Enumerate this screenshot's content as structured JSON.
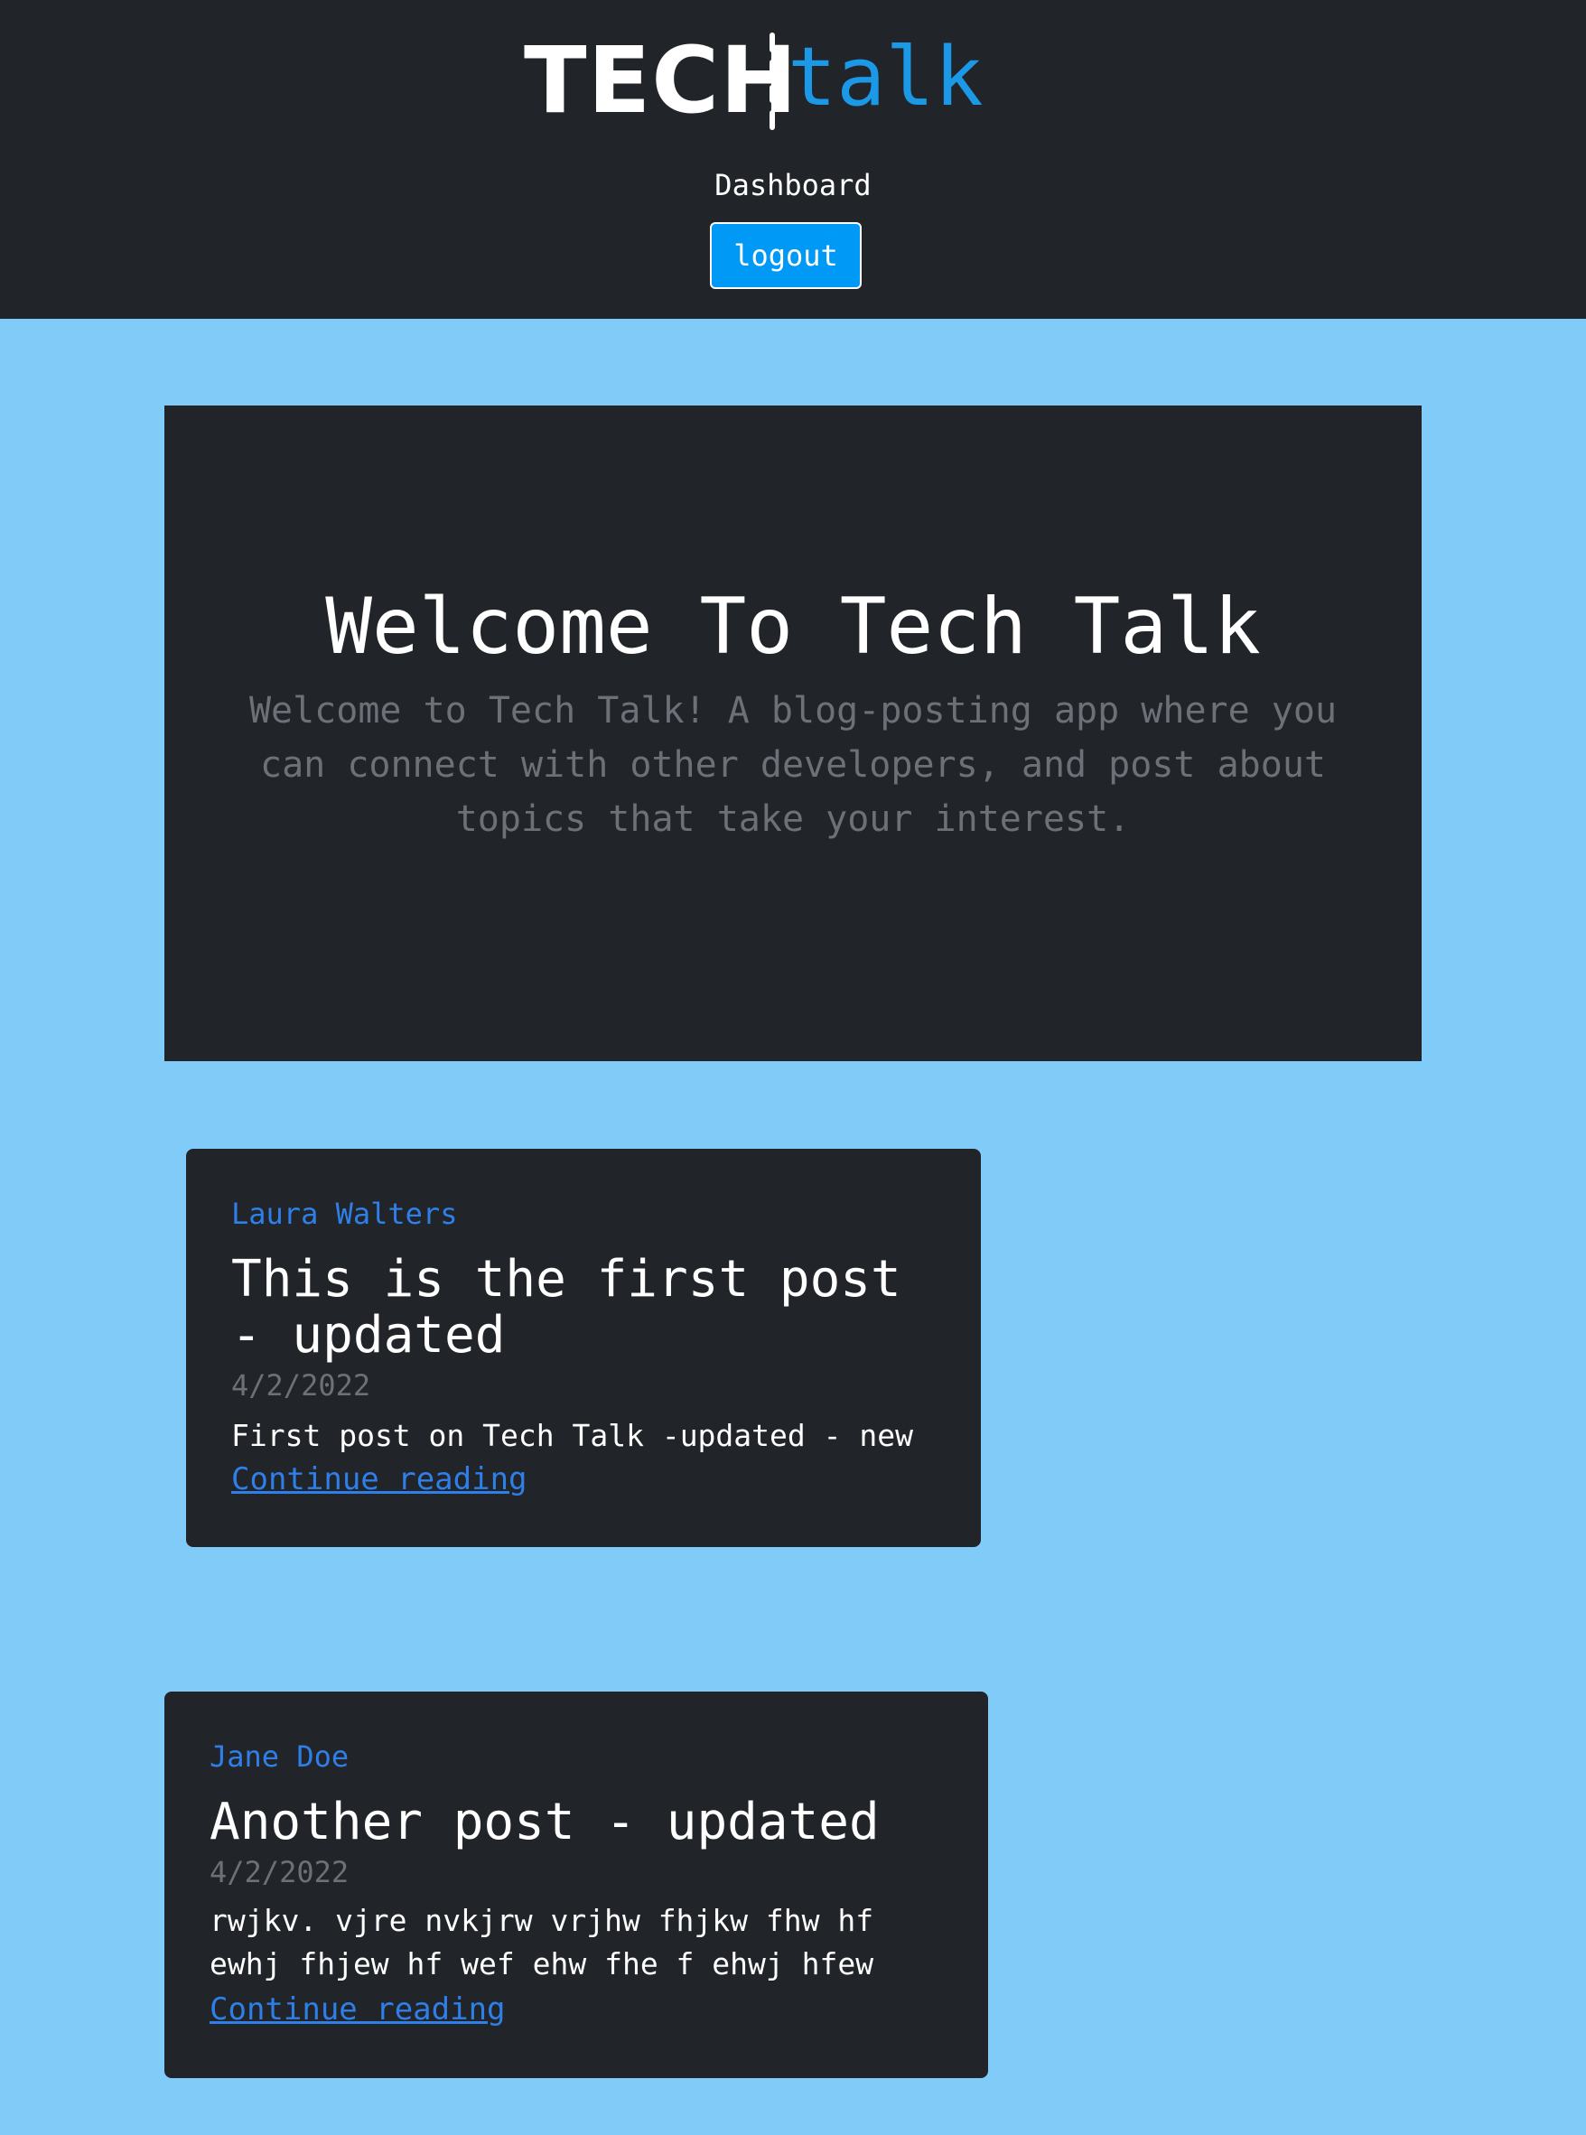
{
  "header": {
    "logo": {
      "word_bold": "TECH",
      "word_light": "talk",
      "accent_color": "#1b98e6"
    },
    "nav": {
      "dashboard_label": "Dashboard"
    },
    "logout_label": "logout",
    "logout_color": "#0199f6"
  },
  "hero": {
    "title": "Welcome To Tech Talk",
    "text": "Welcome to Tech Talk! A blog-posting app where you can connect with other developers, and post about topics that take your interest."
  },
  "posts": [
    {
      "author": "Laura Walters",
      "title": "This is the first post - updated",
      "date": "4/2/2022",
      "body": "First post on Tech Talk -updated - new",
      "link_label": "Continue reading"
    },
    {
      "author": "Jane Doe",
      "title": "Another post - updated",
      "date": "4/2/2022",
      "body": "rwjkv. vjre nvkjrw vrjhw fhjkw fhw hf ewhj fhjew hf wef ehw fhe f ehwj hfew",
      "link_label": "Continue reading"
    }
  ],
  "colors": {
    "page_background": "#80cbf8",
    "card_background": "#212429",
    "author_link": "#2f7fe8"
  }
}
